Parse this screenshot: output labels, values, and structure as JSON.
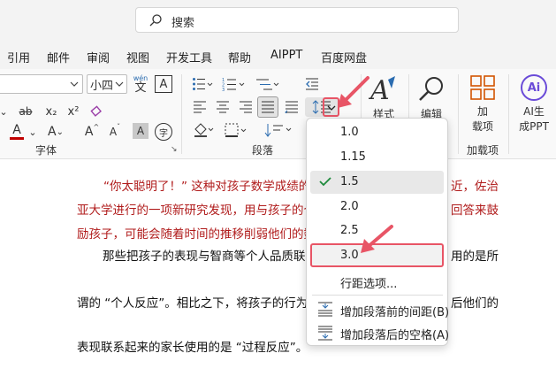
{
  "search": {
    "placeholder": "搜索"
  },
  "menu": {
    "tabs": [
      "引用",
      "邮件",
      "审阅",
      "视图",
      "开发工具",
      "帮助",
      "AIPPT",
      "百度网盘"
    ]
  },
  "ribbon": {
    "font_size": "小四",
    "wen_label": "wén",
    "wen_char": "文",
    "a_box": "A",
    "strike": "ab",
    "sub": "x₂",
    "sup": "x²",
    "font_color_a": "A",
    "highlight_a": "A",
    "grow_a": "A",
    "shrink_a": "A",
    "shade_a": "A",
    "circle_char": "字",
    "groups": {
      "font": "字体",
      "paragraph": "段落",
      "addins": "加载项"
    },
    "styles_label": "样式",
    "edit_label": "编辑",
    "addins_line1": "加",
    "addins_line2": "载项",
    "ai_badge": "Ai",
    "ai_line1": "AI生",
    "ai_line2": "成PPT"
  },
  "document": {
    "lines": [
      "“你太聪明了！” 这种对孩子数学成绩的",
      "亚大学进行的一项新研究发现，用与孩子的个",
      "励孩子，可能会随着时间的推移削弱他们的数",
      "那些把孩子的表现与智商等个人品质联系",
      "谓的 “个人反应”。相比之下，将孩子的行为",
      "表现联系起来的家长使用的是 “过程反应”。"
    ],
    "fragments": [
      "近，佐治",
      "回答来鼓",
      "用的是所",
      "后他们的"
    ]
  },
  "line_spacing_menu": {
    "options": [
      "1.0",
      "1.15",
      "1.5",
      "2.0",
      "2.5",
      "3.0"
    ],
    "checked": "1.5",
    "highlighted": "3.0",
    "more": "行距选项...",
    "add_before": "增加段落前的间距(B)",
    "add_after": "增加段落后的空格(A)"
  },
  "colors": {
    "accent_red": "#e85566",
    "doc_red_text": "#b01b1b",
    "font_color_bar": "#c00000"
  }
}
